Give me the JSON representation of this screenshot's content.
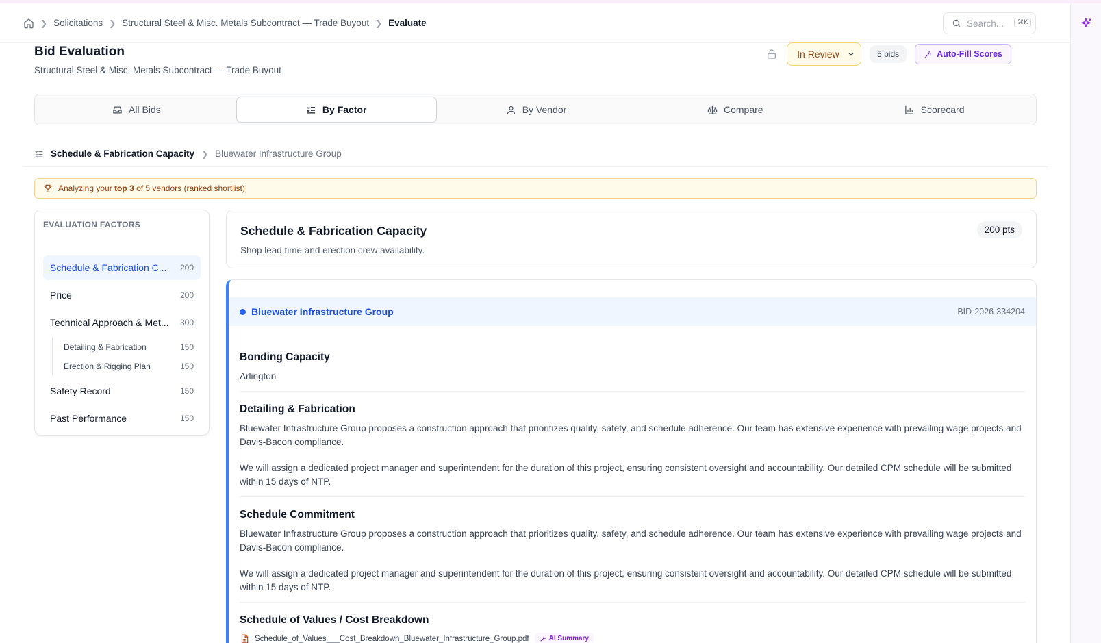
{
  "breadcrumb": {
    "items": [
      "Solicitations",
      "Structural Steel & Misc. Metals Subcontract — Trade Buyout",
      "Evaluate"
    ]
  },
  "search": {
    "placeholder": "Search...",
    "shortcut": "⌘K"
  },
  "header": {
    "title": "Bid Evaluation",
    "subtitle": "Structural Steel & Misc. Metals Subcontract — Trade Buyout",
    "status": "In Review",
    "bids_count": "5 bids",
    "autofill_label": "Auto-Fill Scores"
  },
  "tabs": [
    {
      "label": "All Bids",
      "icon": "inbox-icon"
    },
    {
      "label": "By Factor",
      "icon": "list-checks-icon"
    },
    {
      "label": "By Vendor",
      "icon": "user-icon"
    },
    {
      "label": "Compare",
      "icon": "scale-icon"
    },
    {
      "label": "Scorecard",
      "icon": "bar-chart-icon"
    }
  ],
  "subcrumb": {
    "factor": "Schedule & Fabrication Capacity",
    "vendor": "Bluewater Infrastructure Group"
  },
  "banner": {
    "prefix": "Analyzing your",
    "highlight": "top 3",
    "suffix": "of 5 vendors (ranked shortlist)"
  },
  "factors": {
    "title": "EVALUATION FACTORS",
    "items": [
      {
        "label": "Schedule & Fabrication C...",
        "pts": "200"
      },
      {
        "label": "Price",
        "pts": "200"
      },
      {
        "label": "Technical Approach & Met...",
        "pts": "300"
      },
      {
        "label": "Safety Record",
        "pts": "150"
      },
      {
        "label": "Past Performance",
        "pts": "150"
      }
    ],
    "subitems": [
      {
        "label": "Detailing & Fabrication",
        "pts": "150"
      },
      {
        "label": "Erection & Rigging Plan",
        "pts": "150"
      }
    ]
  },
  "factor_card": {
    "title": "Schedule & Fabrication Capacity",
    "description": "Shop lead time and erection crew availability.",
    "points": "200 pts"
  },
  "bid": {
    "vendor": "Bluewater Infrastructure Group",
    "id": "BID-2026-334204",
    "sections": [
      {
        "title": "Bonding Capacity",
        "p1": "Arlington"
      },
      {
        "title": "Detailing & Fabrication",
        "p1": "Bluewater Infrastructure Group proposes a construction approach that prioritizes quality, safety, and schedule adherence. Our team has extensive experience with prevailing wage projects and Davis-Bacon compliance.",
        "p2": "We will assign a dedicated project manager and superintendent for the duration of this project, ensuring consistent oversight and accountability. Our detailed CPM schedule will be submitted within 15 days of NTP."
      },
      {
        "title": "Schedule Commitment",
        "p1": "Bluewater Infrastructure Group proposes a construction approach that prioritizes quality, safety, and schedule adherence. Our team has extensive experience with prevailing wage projects and Davis-Bacon compliance.",
        "p2": "We will assign a dedicated project manager and superintendent for the duration of this project, ensuring consistent oversight and accountability. Our detailed CPM schedule will be submitted within 15 days of NTP."
      },
      {
        "title": "Schedule of Values / Cost Breakdown",
        "file": "Schedule_of_Values___Cost_Breakdown_Bluewater_Infrastructure_Group.pdf",
        "ai_label": "AI Summary"
      }
    ]
  },
  "colors": {
    "accent": "#2563eb",
    "status_bg": "#fefbe8",
    "ai_purple": "#7e22ce"
  }
}
